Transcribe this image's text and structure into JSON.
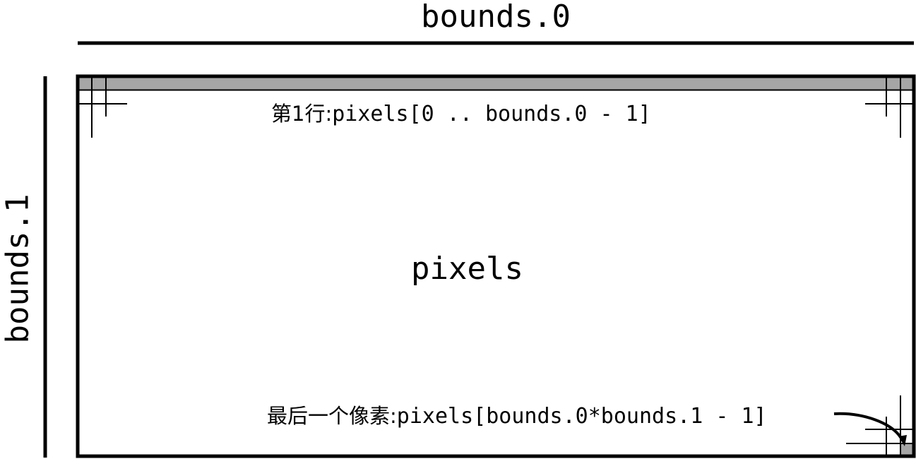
{
  "diagram": {
    "width_label": "bounds.0",
    "height_label": "bounds.1",
    "center_label": "pixels",
    "first_row": {
      "prefix": "第1行:",
      "expression": "pixels[0 .. bounds.0 - 1]"
    },
    "last_pixel": {
      "prefix": "最后一个像素:",
      "expression": "pixels[bounds.0*bounds.1 - 1]"
    },
    "colors": {
      "stroke": "#000000",
      "highlight": "#a6a6a6",
      "background": "#ffffff"
    }
  }
}
